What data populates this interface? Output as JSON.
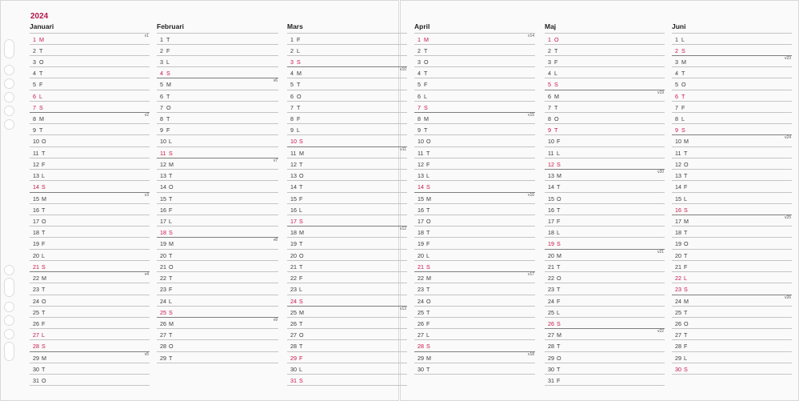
{
  "year": "2024",
  "months": [
    {
      "name": "Januari",
      "days": [
        {
          "d": "1",
          "w": "M",
          "red": true,
          "wk": "v1"
        },
        {
          "d": "2",
          "w": "T"
        },
        {
          "d": "3",
          "w": "O"
        },
        {
          "d": "4",
          "w": "T"
        },
        {
          "d": "5",
          "w": "F"
        },
        {
          "d": "6",
          "w": "L",
          "red": true
        },
        {
          "d": "7",
          "w": "S",
          "red": true
        },
        {
          "d": "8",
          "w": "M",
          "wk": "v2"
        },
        {
          "d": "9",
          "w": "T"
        },
        {
          "d": "10",
          "w": "O"
        },
        {
          "d": "11",
          "w": "T"
        },
        {
          "d": "12",
          "w": "F"
        },
        {
          "d": "13",
          "w": "L"
        },
        {
          "d": "14",
          "w": "S",
          "red": true
        },
        {
          "d": "15",
          "w": "M",
          "wk": "v3"
        },
        {
          "d": "16",
          "w": "T"
        },
        {
          "d": "17",
          "w": "O"
        },
        {
          "d": "18",
          "w": "T"
        },
        {
          "d": "19",
          "w": "F"
        },
        {
          "d": "20",
          "w": "L"
        },
        {
          "d": "21",
          "w": "S",
          "red": true
        },
        {
          "d": "22",
          "w": "M",
          "wk": "v4"
        },
        {
          "d": "23",
          "w": "T"
        },
        {
          "d": "24",
          "w": "O"
        },
        {
          "d": "25",
          "w": "T"
        },
        {
          "d": "26",
          "w": "F"
        },
        {
          "d": "27",
          "w": "L",
          "red": true
        },
        {
          "d": "28",
          "w": "S",
          "red": true
        },
        {
          "d": "29",
          "w": "M",
          "wk": "v5"
        },
        {
          "d": "30",
          "w": "T"
        },
        {
          "d": "31",
          "w": "O"
        }
      ]
    },
    {
      "name": "Februari",
      "days": [
        {
          "d": "1",
          "w": "T"
        },
        {
          "d": "2",
          "w": "F"
        },
        {
          "d": "3",
          "w": "L"
        },
        {
          "d": "4",
          "w": "S",
          "red": true
        },
        {
          "d": "5",
          "w": "M",
          "wk": "v6"
        },
        {
          "d": "6",
          "w": "T"
        },
        {
          "d": "7",
          "w": "O"
        },
        {
          "d": "8",
          "w": "T"
        },
        {
          "d": "9",
          "w": "F"
        },
        {
          "d": "10",
          "w": "L"
        },
        {
          "d": "11",
          "w": "S",
          "red": true
        },
        {
          "d": "12",
          "w": "M",
          "wk": "v7"
        },
        {
          "d": "13",
          "w": "T"
        },
        {
          "d": "14",
          "w": "O"
        },
        {
          "d": "15",
          "w": "T"
        },
        {
          "d": "16",
          "w": "F"
        },
        {
          "d": "17",
          "w": "L"
        },
        {
          "d": "18",
          "w": "S",
          "red": true
        },
        {
          "d": "19",
          "w": "M",
          "wk": "v8"
        },
        {
          "d": "20",
          "w": "T"
        },
        {
          "d": "21",
          "w": "O"
        },
        {
          "d": "22",
          "w": "T"
        },
        {
          "d": "23",
          "w": "F"
        },
        {
          "d": "24",
          "w": "L"
        },
        {
          "d": "25",
          "w": "S",
          "red": true
        },
        {
          "d": "26",
          "w": "M",
          "wk": "v9"
        },
        {
          "d": "27",
          "w": "T"
        },
        {
          "d": "28",
          "w": "O"
        },
        {
          "d": "29",
          "w": "T"
        }
      ]
    },
    {
      "name": "Mars",
      "days": [
        {
          "d": "1",
          "w": "F"
        },
        {
          "d": "2",
          "w": "L"
        },
        {
          "d": "3",
          "w": "S",
          "red": true
        },
        {
          "d": "4",
          "w": "M",
          "wk": "v10"
        },
        {
          "d": "5",
          "w": "T"
        },
        {
          "d": "6",
          "w": "O"
        },
        {
          "d": "7",
          "w": "T"
        },
        {
          "d": "8",
          "w": "F"
        },
        {
          "d": "9",
          "w": "L"
        },
        {
          "d": "10",
          "w": "S",
          "red": true
        },
        {
          "d": "11",
          "w": "M",
          "wk": "v11"
        },
        {
          "d": "12",
          "w": "T"
        },
        {
          "d": "13",
          "w": "O"
        },
        {
          "d": "14",
          "w": "T"
        },
        {
          "d": "15",
          "w": "F"
        },
        {
          "d": "16",
          "w": "L"
        },
        {
          "d": "17",
          "w": "S",
          "red": true
        },
        {
          "d": "18",
          "w": "M",
          "wk": "v12"
        },
        {
          "d": "19",
          "w": "T"
        },
        {
          "d": "20",
          "w": "O"
        },
        {
          "d": "21",
          "w": "T"
        },
        {
          "d": "22",
          "w": "F"
        },
        {
          "d": "23",
          "w": "L"
        },
        {
          "d": "24",
          "w": "S",
          "red": true
        },
        {
          "d": "25",
          "w": "M",
          "wk": "v13"
        },
        {
          "d": "26",
          "w": "T"
        },
        {
          "d": "27",
          "w": "O"
        },
        {
          "d": "28",
          "w": "T"
        },
        {
          "d": "29",
          "w": "F",
          "red": true
        },
        {
          "d": "30",
          "w": "L"
        },
        {
          "d": "31",
          "w": "S",
          "red": true
        }
      ]
    },
    {
      "name": "April",
      "days": [
        {
          "d": "1",
          "w": "M",
          "red": true,
          "wk": "v14"
        },
        {
          "d": "2",
          "w": "T"
        },
        {
          "d": "3",
          "w": "O"
        },
        {
          "d": "4",
          "w": "T"
        },
        {
          "d": "5",
          "w": "F"
        },
        {
          "d": "6",
          "w": "L"
        },
        {
          "d": "7",
          "w": "S",
          "red": true
        },
        {
          "d": "8",
          "w": "M",
          "wk": "v15"
        },
        {
          "d": "9",
          "w": "T"
        },
        {
          "d": "10",
          "w": "O"
        },
        {
          "d": "11",
          "w": "T"
        },
        {
          "d": "12",
          "w": "F"
        },
        {
          "d": "13",
          "w": "L"
        },
        {
          "d": "14",
          "w": "S",
          "red": true
        },
        {
          "d": "15",
          "w": "M",
          "wk": "v16"
        },
        {
          "d": "16",
          "w": "T"
        },
        {
          "d": "17",
          "w": "O"
        },
        {
          "d": "18",
          "w": "T"
        },
        {
          "d": "19",
          "w": "F"
        },
        {
          "d": "20",
          "w": "L"
        },
        {
          "d": "21",
          "w": "S",
          "red": true
        },
        {
          "d": "22",
          "w": "M",
          "wk": "v17"
        },
        {
          "d": "23",
          "w": "T"
        },
        {
          "d": "24",
          "w": "O"
        },
        {
          "d": "25",
          "w": "T"
        },
        {
          "d": "26",
          "w": "F"
        },
        {
          "d": "27",
          "w": "L"
        },
        {
          "d": "28",
          "w": "S",
          "red": true
        },
        {
          "d": "29",
          "w": "M",
          "wk": "v18"
        },
        {
          "d": "30",
          "w": "T"
        }
      ]
    },
    {
      "name": "Maj",
      "days": [
        {
          "d": "1",
          "w": "O",
          "red": true
        },
        {
          "d": "2",
          "w": "T"
        },
        {
          "d": "3",
          "w": "F"
        },
        {
          "d": "4",
          "w": "L"
        },
        {
          "d": "5",
          "w": "S",
          "red": true
        },
        {
          "d": "6",
          "w": "M",
          "wk": "v19"
        },
        {
          "d": "7",
          "w": "T"
        },
        {
          "d": "8",
          "w": "O"
        },
        {
          "d": "9",
          "w": "T",
          "red": true
        },
        {
          "d": "10",
          "w": "F"
        },
        {
          "d": "11",
          "w": "L"
        },
        {
          "d": "12",
          "w": "S",
          "red": true
        },
        {
          "d": "13",
          "w": "M",
          "wk": "v20"
        },
        {
          "d": "14",
          "w": "T"
        },
        {
          "d": "15",
          "w": "O"
        },
        {
          "d": "16",
          "w": "T"
        },
        {
          "d": "17",
          "w": "F"
        },
        {
          "d": "18",
          "w": "L"
        },
        {
          "d": "19",
          "w": "S",
          "red": true
        },
        {
          "d": "20",
          "w": "M",
          "wk": "v21"
        },
        {
          "d": "21",
          "w": "T"
        },
        {
          "d": "22",
          "w": "O"
        },
        {
          "d": "23",
          "w": "T"
        },
        {
          "d": "24",
          "w": "F"
        },
        {
          "d": "25",
          "w": "L"
        },
        {
          "d": "26",
          "w": "S",
          "red": true
        },
        {
          "d": "27",
          "w": "M",
          "wk": "v22"
        },
        {
          "d": "28",
          "w": "T"
        },
        {
          "d": "29",
          "w": "O"
        },
        {
          "d": "30",
          "w": "T"
        },
        {
          "d": "31",
          "w": "F"
        }
      ]
    },
    {
      "name": "Juni",
      "days": [
        {
          "d": "1",
          "w": "L"
        },
        {
          "d": "2",
          "w": "S",
          "red": true
        },
        {
          "d": "3",
          "w": "M",
          "wk": "v23"
        },
        {
          "d": "4",
          "w": "T"
        },
        {
          "d": "5",
          "w": "O"
        },
        {
          "d": "6",
          "w": "T",
          "red": true
        },
        {
          "d": "7",
          "w": "F"
        },
        {
          "d": "8",
          "w": "L"
        },
        {
          "d": "9",
          "w": "S",
          "red": true
        },
        {
          "d": "10",
          "w": "M",
          "wk": "v24"
        },
        {
          "d": "11",
          "w": "T"
        },
        {
          "d": "12",
          "w": "O"
        },
        {
          "d": "13",
          "w": "T"
        },
        {
          "d": "14",
          "w": "F"
        },
        {
          "d": "15",
          "w": "L"
        },
        {
          "d": "16",
          "w": "S",
          "red": true
        },
        {
          "d": "17",
          "w": "M",
          "wk": "v25"
        },
        {
          "d": "18",
          "w": "T"
        },
        {
          "d": "19",
          "w": "O"
        },
        {
          "d": "20",
          "w": "T"
        },
        {
          "d": "21",
          "w": "F"
        },
        {
          "d": "22",
          "w": "L",
          "red": true
        },
        {
          "d": "23",
          "w": "S",
          "red": true
        },
        {
          "d": "24",
          "w": "M",
          "wk": "v26"
        },
        {
          "d": "25",
          "w": "T"
        },
        {
          "d": "26",
          "w": "O"
        },
        {
          "d": "27",
          "w": "T"
        },
        {
          "d": "28",
          "w": "F"
        },
        {
          "d": "29",
          "w": "L"
        },
        {
          "d": "30",
          "w": "S",
          "red": true
        }
      ]
    }
  ]
}
